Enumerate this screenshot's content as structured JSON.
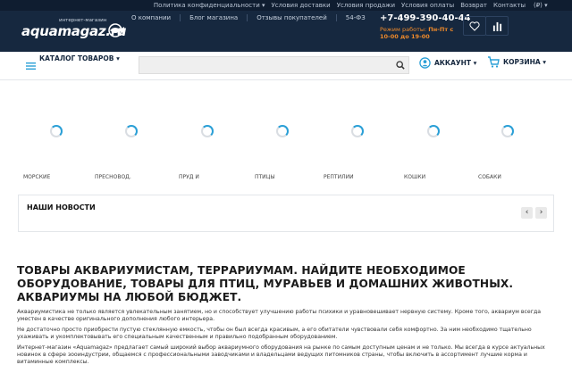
{
  "topbar": {
    "links": [
      "Политика конфиденциальности ▾",
      "Условия доставки",
      "Условия продажи",
      "Условия оплаты",
      "Возврат",
      "Контакты"
    ],
    "currency": "(₽) ▾"
  },
  "logo": {
    "small": "интернет-магазин",
    "text": "aquamagaz.ru"
  },
  "nav": {
    "links": [
      "О компании",
      "Блог магазина",
      "Отзывы покупателей",
      "54-ФЗ"
    ]
  },
  "contact": {
    "phone": "+7-499-390-40-44",
    "hours_prefix": "Режим работы: ",
    "hours": "Пн-Пт с 10-00 до 19-00"
  },
  "navbar": {
    "catalog": "КАТАЛОГ ТОВАРОВ ▾",
    "account": "АККАУНТ ▾",
    "cart": "КОРЗИНА ▾",
    "search_placeholder": ""
  },
  "categories": [
    "МОРСКИЕ",
    "ПРЕСНОВОД.",
    "ПРУД И",
    "ПТИЦЫ",
    "РЕПТИЛИИ",
    "КОШКИ",
    "СОБАКИ"
  ],
  "news": {
    "title": "НАШИ НОВОСТИ",
    "prev": "‹",
    "next": "›"
  },
  "seo": {
    "heading": "ТОВАРЫ  АКВАРИУМИСТАМ, ТЕРРАРИУМАМ. НАЙДИТЕ НЕОБХОДИМОЕ ОБОРУДОВАНИЕ, ТОВАРЫ ДЛЯ ПТИЦ, МУРАВЬЕВ И ДОМАШНИХ ЖИВОТНЫХ. АКВАРИУМЫ НА ЛЮБОЙ БЮДЖЕТ.",
    "p1": "Аквариумистика не только является увлекательным занятием, но и способствует улучшению работы психики и уравновешивает нервную систему. Кроме того, аквариум всегда уместен в качестве оригинального дополнения любого интерьера.",
    "p2": "Не достаточно просто приобрести пустую стеклянную емкость, чтобы он был всегда красивым, а его обитатели чувствовали себя комфортно. За ним необходимо тщательно ухаживать и укомплектовывать его специальным качественным и правильно подобранным оборудованием.",
    "p3": "Интернет-магазин «Aquamagaz» предлагает самый широкий выбор аквариумного оборудования на рынке по самым доступным ценам и не только. Мы всегда в курсе актуальных новинок в сфере зооиндустрии, общаемся с профессиональными заводчиками и владельцами ведущих питомников страны, чтобы включить в ассортимент лучшие корма и витаминные комплексы."
  },
  "colors": {
    "header_bg": "#16283f",
    "accent": "#f08a2a",
    "spinner": "#2a9fd6"
  }
}
